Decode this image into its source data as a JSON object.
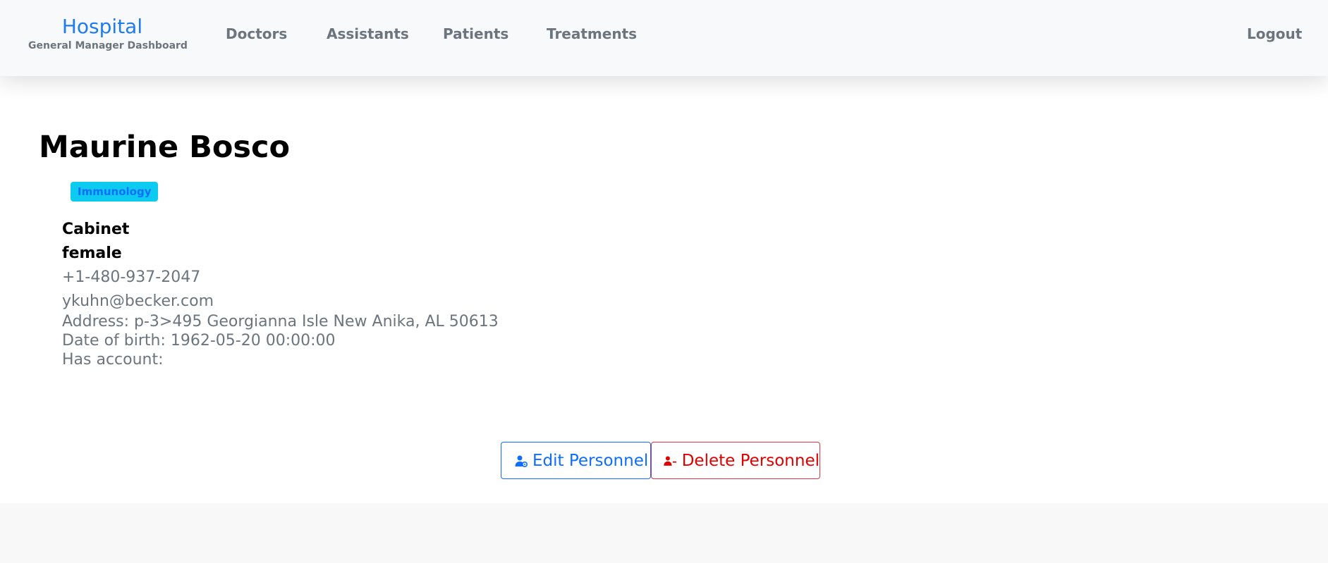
{
  "nav": {
    "brand_title": "Hospital",
    "brand_subtitle": "General Manager Dashboard",
    "links": [
      "Doctors",
      "Assistants",
      "Patients",
      "Treatments"
    ],
    "logout": "Logout"
  },
  "profile": {
    "name": "Maurine Bosco",
    "specialty": "Immunology",
    "role": "Cabinet",
    "gender": "female",
    "phone": "+1-480-937-2047",
    "email": "ykuhn@becker.com",
    "address": "Address: p-3>495 Georgianna Isle New Anika, AL 50613",
    "dob": "Date of birth: 1962-05-20 00:00:00",
    "has_account": "Has account:"
  },
  "actions": {
    "edit_label": "Edit Personnel",
    "delete_label": "Delete Personnel"
  },
  "colors": {
    "brand": "#1e7bf0",
    "primary": "#0d6efd",
    "danger": "#e00000",
    "info_badge": "#0dcaf0"
  }
}
